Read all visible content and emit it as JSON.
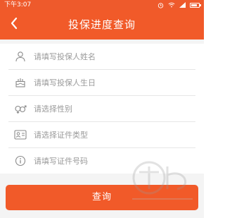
{
  "status_bar": {
    "time": "下午3:07",
    "icons": [
      "alarm-icon",
      "wifi-icon",
      "signal-icon",
      "battery-icon"
    ]
  },
  "header": {
    "title": "投保进度查询",
    "back_icon": "chevron-left-icon"
  },
  "form": {
    "fields": [
      {
        "icon": "person-icon",
        "placeholder": "请填写投保人姓名"
      },
      {
        "icon": "cake-icon",
        "placeholder": "请填写投保人生日"
      },
      {
        "icon": "gender-icon",
        "placeholder": "请选择性别"
      },
      {
        "icon": "id-card-icon",
        "placeholder": "请选择证件类型"
      },
      {
        "icon": "info-icon",
        "placeholder": "请填写证件号码"
      }
    ]
  },
  "actions": {
    "query_label": "查询"
  },
  "colors": {
    "accent": "#f15a29",
    "placeholder": "#9a9a9a",
    "divider": "#e6e6e6"
  }
}
